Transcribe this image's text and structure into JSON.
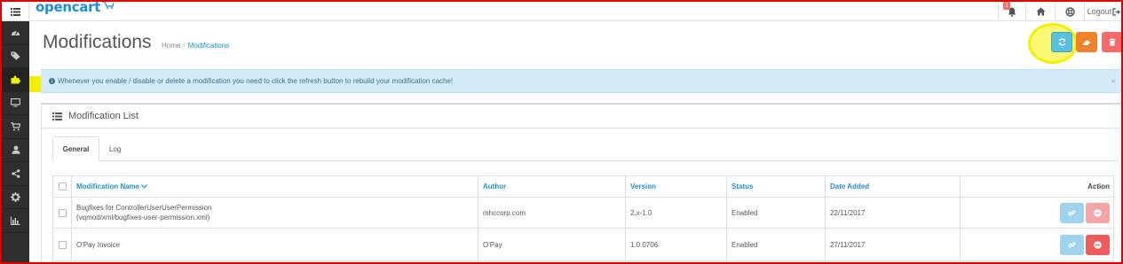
{
  "brand": "opencart",
  "top": {
    "notification_count": "1",
    "logout_label": "Logout"
  },
  "page": {
    "title": "Modifications",
    "breadcrumb": [
      "Home",
      "Modifications"
    ]
  },
  "alert": {
    "message": "Whenever you enable / disable or delete a modification you need to click the refresh button to rebuild your modification cache!",
    "close": "×"
  },
  "panel": {
    "title": "Modification List",
    "tabs": [
      "General",
      "Log"
    ]
  },
  "table": {
    "headers": {
      "name": "Modification Name",
      "author": "Author",
      "version": "Version",
      "status": "Status",
      "date_added": "Date Added",
      "action": "Action"
    },
    "rows": [
      {
        "name_line1": "Bugfixes for ControllerUserUserPermission",
        "name_line2": "(vqmod/xml/bugfixes-user-permission.xml)",
        "author": "mhccorp.com",
        "version": "2.x-1.0",
        "status": "Enabled",
        "date_added": "22/11/2017"
      },
      {
        "name_line1": "O'Pay Invoice",
        "name_line2": "",
        "author": "O'Pay",
        "version": "1.0.0706",
        "status": "Enabled",
        "date_added": "27/11/2017"
      }
    ]
  },
  "icons": [
    "menu-icon",
    "bell-icon",
    "home-icon",
    "lifebuoy-icon",
    "logout-icon",
    "dashboard-icon",
    "tag-icon",
    "puzzle-icon",
    "desktop-icon",
    "cart-icon",
    "user-icon",
    "share-icon",
    "cog-icon",
    "bar-chart-icon",
    "refresh-icon",
    "eraser-icon",
    "trash-icon",
    "info-icon",
    "list-icon",
    "link-icon",
    "minus-circle-icon"
  ],
  "colors": {
    "brand": "#1b8ed6",
    "sidebar": "#2f2f2f",
    "refresh": "#5bc0de",
    "clear": "#f0812d",
    "delete": "#f56b6b",
    "alert_bg": "#d3ecf7",
    "highlight": "#f4f000"
  }
}
